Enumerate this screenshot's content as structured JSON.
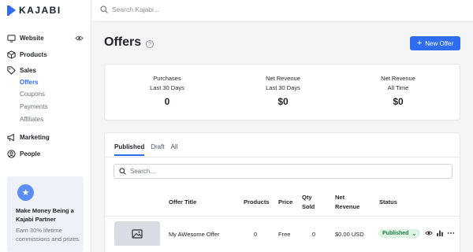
{
  "brand": {
    "name": "KAJABI"
  },
  "topbar": {
    "search_placeholder": "Search Kajabi..."
  },
  "sidebar": {
    "items": [
      {
        "label": "Website",
        "icon": "monitor-icon"
      },
      {
        "label": "Products",
        "icon": "box-icon"
      },
      {
        "label": "Sales",
        "icon": "tag-icon"
      },
      {
        "label": "Marketing",
        "icon": "megaphone-icon"
      },
      {
        "label": "People",
        "icon": "person-icon"
      }
    ],
    "sales_sub": [
      "Offers",
      "Coupons",
      "Payments",
      "Affiliates"
    ],
    "active_sub": "Offers"
  },
  "promo": {
    "title": "Make Money Being a Kajabi Partner",
    "desc": "Earn 30% lifetime commissions and prizes."
  },
  "header": {
    "title": "Offers",
    "new_offer_label": "New Offer"
  },
  "stats": [
    {
      "label1": "Purchases",
      "label2": "Last 30 Days",
      "value": "0"
    },
    {
      "label1": "Net Revenue",
      "label2": "Last 30 Days",
      "value": "$0"
    },
    {
      "label1": "Net Revenue",
      "label2": "All Time",
      "value": "$0"
    }
  ],
  "tabs": [
    "Published",
    "Draft",
    "All"
  ],
  "search": {
    "placeholder": "Search..."
  },
  "table": {
    "headers": {
      "title": "Offer Title",
      "products": "Products",
      "price": "Price",
      "qty1": "Qty",
      "qty2": "Sold",
      "net1": "Net",
      "net2": "Revenue",
      "status": "Status"
    },
    "rows": [
      {
        "title": "My AWesome Offer",
        "products": "0",
        "price": "Free",
        "qty": "0",
        "revenue": "$0.00 USD",
        "status": "Published"
      }
    ]
  },
  "colors": {
    "accent": "#2f6df0",
    "published_bg": "#def3e4",
    "published_text": "#1d7a3e"
  }
}
